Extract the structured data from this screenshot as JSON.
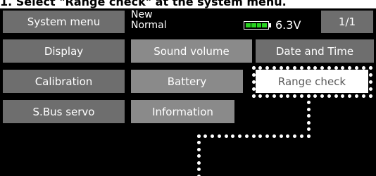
{
  "caption": "1. Select \"Range check\" at the system menu.",
  "header": {
    "title": "System menu",
    "model_name": "New",
    "model_mode": "Normal",
    "voltage": "6.3V",
    "page": "1/1",
    "battery_level": 1.0,
    "battery_color": "#27d31f"
  },
  "menu": {
    "display": "Display",
    "sound_volume": "Sound volume",
    "date_and_time": "Date and Time",
    "calibration": "Calibration",
    "battery": "Battery",
    "range_check": "Range check",
    "sbus_servo": "S.Bus servo",
    "information": "Information"
  },
  "colors": {
    "button": "#6e6e6e",
    "button_alt": "#8a8a8a",
    "selected": "#ffffff",
    "screen": "#000000"
  }
}
